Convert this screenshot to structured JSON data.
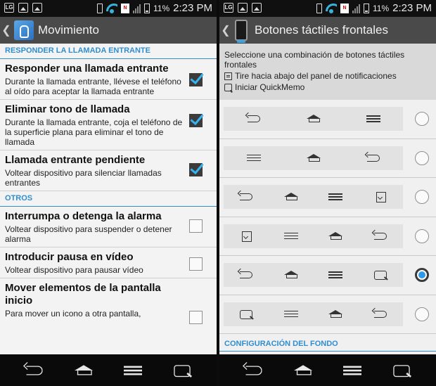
{
  "status_bar": {
    "battery": "11%",
    "time": "2:23 PM"
  },
  "left": {
    "title": "Movimiento",
    "section_incoming": "RESPONDER LA LLAMADA ENTRANTE",
    "section_other": "OTROS",
    "items": [
      {
        "title": "Responder una llamada entrante",
        "summary": "Durante la llamada entrante, llévese el teléfono al oído para aceptar la llamada entrante",
        "checked": true
      },
      {
        "title": "Eliminar tono de llamada",
        "summary": "Durante la llamada entrante, coja el teléfono de la superficie plana para eliminar el tono de llamada",
        "checked": true
      },
      {
        "title": "Llamada entrante pendiente",
        "summary": "Voltear dispositivo para silenciar llamadas entrantes",
        "checked": true
      },
      {
        "title": "Interrumpa o detenga la alarma",
        "summary": "Voltear dispositivo para suspender o detener alarma",
        "checked": false
      },
      {
        "title": "Introducir pausa en vídeo",
        "summary": "Voltear dispositivo para pausar vídeo",
        "checked": false
      },
      {
        "title": "Mover elementos de la pantalla inicio",
        "summary": "Para mover un icono a otra pantalla,",
        "checked": false
      }
    ]
  },
  "right": {
    "title": "Botones táctiles frontales",
    "instruction": "Seleccione una combinación de botones táctiles frontales",
    "legend_notifications": "Tire hacia abajo del panel de notificaciones",
    "legend_quickmemo": "Iniciar QuickMemo",
    "options": [
      {
        "icons": [
          "back-icon",
          "home-icon",
          "menu-icon"
        ],
        "selected": false
      },
      {
        "icons": [
          "menu-icon",
          "home-icon",
          "back-icon"
        ],
        "selected": false
      },
      {
        "icons": [
          "back-icon",
          "home-icon",
          "menu-icon",
          "notification-icon"
        ],
        "selected": false
      },
      {
        "icons": [
          "notification-icon",
          "menu-icon",
          "home-icon",
          "back-icon"
        ],
        "selected": false
      },
      {
        "icons": [
          "back-icon",
          "home-icon",
          "menu-icon",
          "quickmemo-icon"
        ],
        "selected": true
      },
      {
        "icons": [
          "quickmemo-icon",
          "menu-icon",
          "home-icon",
          "back-icon"
        ],
        "selected": false
      }
    ],
    "section_background": "CONFIGURACIÓN DEL FONDO"
  },
  "nav_icons": [
    "back-icon",
    "home-icon",
    "menu-icon",
    "quickmemo-icon"
  ],
  "colors": {
    "accent": "#2f8ed0",
    "action_bar": "#4a4a4a",
    "radio_selected": "#2f9ae8",
    "checkmark": "#37b4f0"
  }
}
